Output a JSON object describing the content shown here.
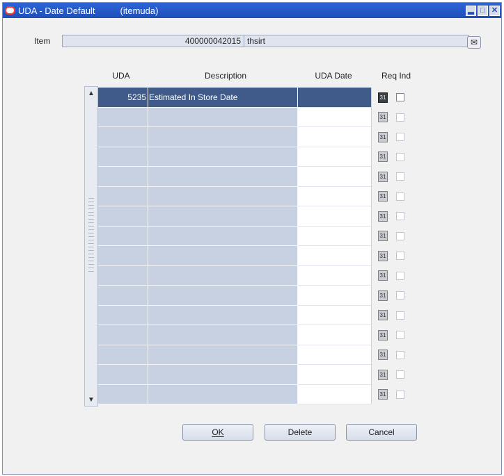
{
  "window": {
    "title": "UDA - Date Default",
    "module": "(itemuda)",
    "min_label": "▂",
    "max_label": "□",
    "close_label": "✕"
  },
  "item": {
    "label": "Item",
    "number": "400000042015",
    "description": "thsirt",
    "edit_icon": "✉"
  },
  "grid": {
    "columns": [
      "UDA",
      "Description",
      "UDA Date",
      "Req Ind"
    ],
    "calendar_icon_label": "31",
    "rows": [
      {
        "uda": "5235",
        "description": "Estimated In Store Date",
        "date": "",
        "selected": true
      },
      {
        "uda": "",
        "description": "",
        "date": ""
      },
      {
        "uda": "",
        "description": "",
        "date": ""
      },
      {
        "uda": "",
        "description": "",
        "date": ""
      },
      {
        "uda": "",
        "description": "",
        "date": ""
      },
      {
        "uda": "",
        "description": "",
        "date": ""
      },
      {
        "uda": "",
        "description": "",
        "date": ""
      },
      {
        "uda": "",
        "description": "",
        "date": ""
      },
      {
        "uda": "",
        "description": "",
        "date": ""
      },
      {
        "uda": "",
        "description": "",
        "date": ""
      },
      {
        "uda": "",
        "description": "",
        "date": ""
      },
      {
        "uda": "",
        "description": "",
        "date": ""
      },
      {
        "uda": "",
        "description": "",
        "date": ""
      },
      {
        "uda": "",
        "description": "",
        "date": ""
      },
      {
        "uda": "",
        "description": "",
        "date": ""
      },
      {
        "uda": "",
        "description": "",
        "date": ""
      }
    ]
  },
  "scroll": {
    "up": "▲",
    "down": "▼"
  },
  "buttons": {
    "ok": "OK",
    "delete": "Delete",
    "cancel": "Cancel"
  }
}
